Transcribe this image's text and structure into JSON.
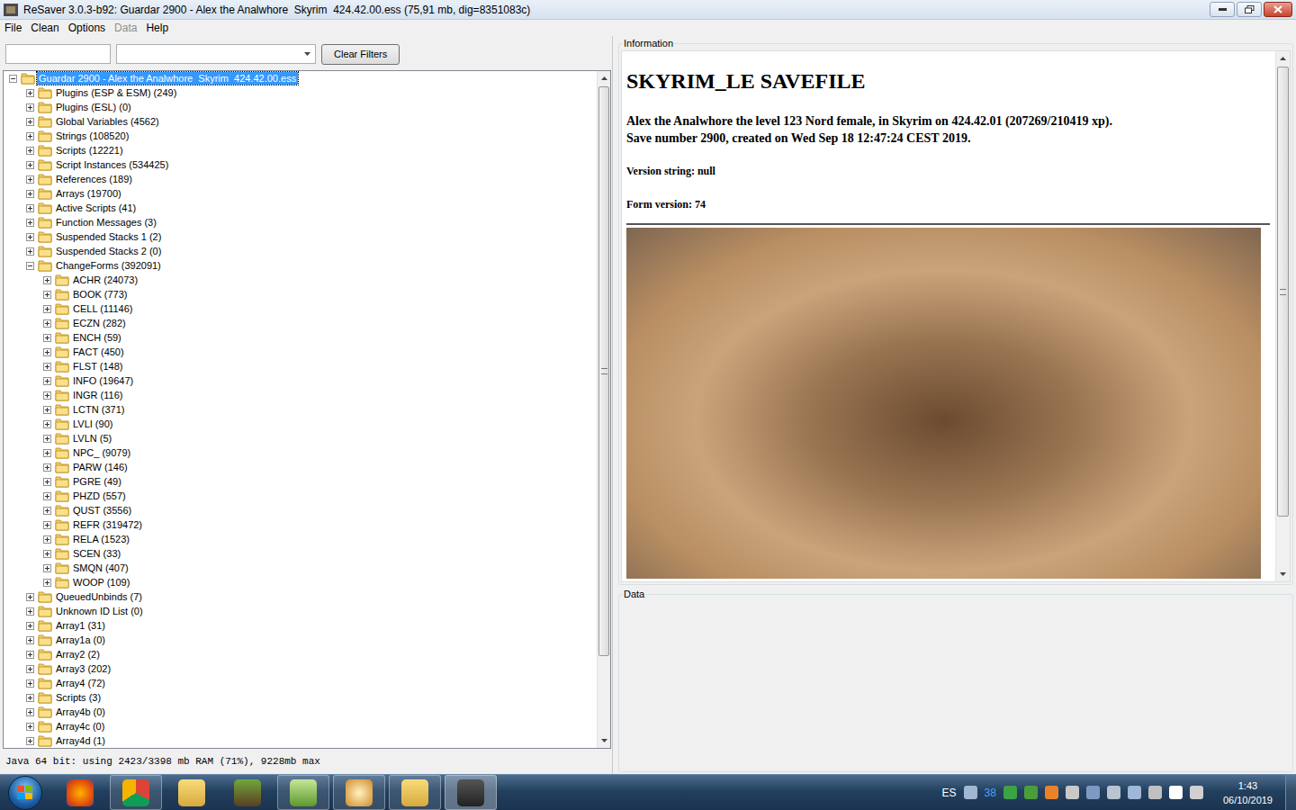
{
  "window": {
    "title": "ReSaver 3.0.3-b92: Guardar 2900 - Alex the Analwhore  Skyrim  424.42.00.ess (75,91 mb, dig=8351083c)"
  },
  "menu": [
    {
      "label": "File",
      "disabled": false
    },
    {
      "label": "Clean",
      "disabled": false
    },
    {
      "label": "Options",
      "disabled": false
    },
    {
      "label": "Data",
      "disabled": true
    },
    {
      "label": "Help",
      "disabled": false
    }
  ],
  "filters": {
    "button": "Clear Filters"
  },
  "tree": [
    {
      "label": "Guardar 2900 - Alex the Analwhore  Skyrim  424.42.00.ess",
      "depth": 0,
      "expanded": true,
      "selected": true
    },
    {
      "label": "Plugins (ESP & ESM) (249)",
      "depth": 1,
      "expanded": false,
      "selected": false
    },
    {
      "label": "Plugins (ESL) (0)",
      "depth": 1,
      "expanded": false,
      "selected": false
    },
    {
      "label": "Global Variables (4562)",
      "depth": 1,
      "expanded": false,
      "selected": false
    },
    {
      "label": "Strings (108520)",
      "depth": 1,
      "expanded": false,
      "selected": false
    },
    {
      "label": "Scripts (12221)",
      "depth": 1,
      "expanded": false,
      "selected": false
    },
    {
      "label": "Script Instances (534425)",
      "depth": 1,
      "expanded": false,
      "selected": false
    },
    {
      "label": "References (189)",
      "depth": 1,
      "expanded": false,
      "selected": false
    },
    {
      "label": "Arrays (19700)",
      "depth": 1,
      "expanded": false,
      "selected": false
    },
    {
      "label": "Active Scripts (41)",
      "depth": 1,
      "expanded": false,
      "selected": false
    },
    {
      "label": "Function Messages (3)",
      "depth": 1,
      "expanded": false,
      "selected": false
    },
    {
      "label": "Suspended Stacks 1 (2)",
      "depth": 1,
      "expanded": false,
      "selected": false
    },
    {
      "label": "Suspended Stacks 2 (0)",
      "depth": 1,
      "expanded": false,
      "selected": false
    },
    {
      "label": "ChangeForms (392091)",
      "depth": 1,
      "expanded": true,
      "selected": false
    },
    {
      "label": "ACHR (24073)",
      "depth": 2,
      "expanded": false,
      "selected": false
    },
    {
      "label": "BOOK (773)",
      "depth": 2,
      "expanded": false,
      "selected": false
    },
    {
      "label": "CELL (11146)",
      "depth": 2,
      "expanded": false,
      "selected": false
    },
    {
      "label": "ECZN (282)",
      "depth": 2,
      "expanded": false,
      "selected": false
    },
    {
      "label": "ENCH (59)",
      "depth": 2,
      "expanded": false,
      "selected": false
    },
    {
      "label": "FACT (450)",
      "depth": 2,
      "expanded": false,
      "selected": false
    },
    {
      "label": "FLST (148)",
      "depth": 2,
      "expanded": false,
      "selected": false
    },
    {
      "label": "INFO (19647)",
      "depth": 2,
      "expanded": false,
      "selected": false
    },
    {
      "label": "INGR (116)",
      "depth": 2,
      "expanded": false,
      "selected": false
    },
    {
      "label": "LCTN (371)",
      "depth": 2,
      "expanded": false,
      "selected": false
    },
    {
      "label": "LVLI (90)",
      "depth": 2,
      "expanded": false,
      "selected": false
    },
    {
      "label": "LVLN (5)",
      "depth": 2,
      "expanded": false,
      "selected": false
    },
    {
      "label": "NPC_ (9079)",
      "depth": 2,
      "expanded": false,
      "selected": false
    },
    {
      "label": "PARW (146)",
      "depth": 2,
      "expanded": false,
      "selected": false
    },
    {
      "label": "PGRE (49)",
      "depth": 2,
      "expanded": false,
      "selected": false
    },
    {
      "label": "PHZD (557)",
      "depth": 2,
      "expanded": false,
      "selected": false
    },
    {
      "label": "QUST (3556)",
      "depth": 2,
      "expanded": false,
      "selected": false
    },
    {
      "label": "REFR (319472)",
      "depth": 2,
      "expanded": false,
      "selected": false
    },
    {
      "label": "RELA (1523)",
      "depth": 2,
      "expanded": false,
      "selected": false
    },
    {
      "label": "SCEN (33)",
      "depth": 2,
      "expanded": false,
      "selected": false
    },
    {
      "label": "SMQN (407)",
      "depth": 2,
      "expanded": false,
      "selected": false
    },
    {
      "label": "WOOP (109)",
      "depth": 2,
      "expanded": false,
      "selected": false
    },
    {
      "label": "QueuedUnbinds (7)",
      "depth": 1,
      "expanded": false,
      "selected": false
    },
    {
      "label": "Unknown ID List (0)",
      "depth": 1,
      "expanded": false,
      "selected": false
    },
    {
      "label": "Array1 (31)",
      "depth": 1,
      "expanded": false,
      "selected": false
    },
    {
      "label": "Array1a (0)",
      "depth": 1,
      "expanded": false,
      "selected": false
    },
    {
      "label": "Array2 (2)",
      "depth": 1,
      "expanded": false,
      "selected": false
    },
    {
      "label": "Array3 (202)",
      "depth": 1,
      "expanded": false,
      "selected": false
    },
    {
      "label": "Array4 (72)",
      "depth": 1,
      "expanded": false,
      "selected": false
    },
    {
      "label": "Scripts (3)",
      "depth": 1,
      "expanded": false,
      "selected": false
    },
    {
      "label": "Array4b (0)",
      "depth": 1,
      "expanded": false,
      "selected": false
    },
    {
      "label": "Array4c (0)",
      "depth": 1,
      "expanded": false,
      "selected": false
    },
    {
      "label": "Array4d (1)",
      "depth": 1,
      "expanded": false,
      "selected": false
    }
  ],
  "status_bar": "Java 64 bit: using 2423/3398 mb RAM (71%), 9228mb max",
  "information": {
    "legend": "Information",
    "heading": "SKYRIM_LE SAVEFILE",
    "lines": [
      "Alex the Analwhore the level 123 Nord female, in Skyrim on 424.42.01 (207269/210419 xp).",
      "Save number 2900, created on Wed Sep 18 12:47:24 CEST 2019."
    ],
    "version": "Version string: null",
    "form_version": "Form version: 74"
  },
  "data_panel": {
    "legend": "Data"
  },
  "taskbar": {
    "apps": [
      {
        "running": false,
        "selected": false
      },
      {
        "running": true,
        "selected": false
      },
      {
        "running": false,
        "selected": false
      },
      {
        "running": false,
        "selected": false
      },
      {
        "running": true,
        "selected": false
      },
      {
        "running": true,
        "selected": false
      },
      {
        "running": true,
        "selected": false
      },
      {
        "running": true,
        "selected": true
      }
    ],
    "tray": {
      "language": "ES",
      "badge": "38",
      "time": "1:43",
      "date": "06/10/2019"
    }
  }
}
